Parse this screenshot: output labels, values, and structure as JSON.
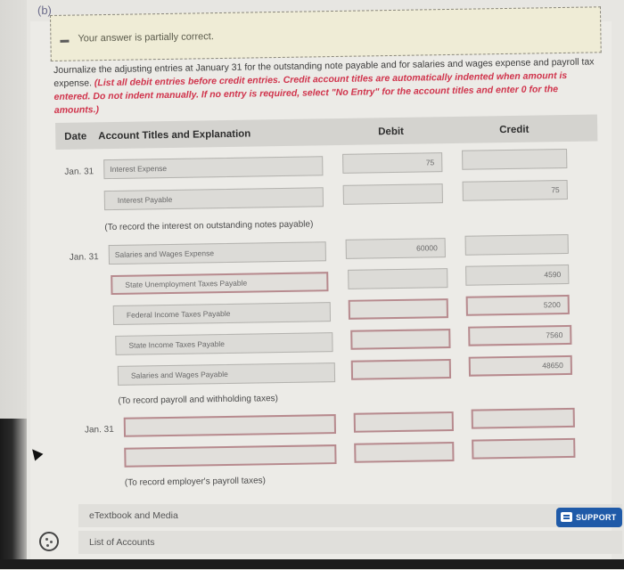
{
  "part_label": "(b)",
  "feedback": {
    "icon": "minus-icon",
    "message": "Your answer is partially correct."
  },
  "instructions": {
    "plain": "Journalize the adjusting entries at January 31 for the outstanding note payable and for salaries and wages expense and payroll tax expense. ",
    "emphasis": "(List all debit entries before credit entries. Credit account titles are automatically indented when amount is entered. Do not indent manually. If no entry is required, select \"No Entry\" for the account titles and enter 0 for the amounts.)"
  },
  "table": {
    "headers": {
      "date": "Date",
      "account": "Account Titles and Explanation",
      "debit": "Debit",
      "credit": "Credit"
    },
    "entries": [
      {
        "date": "Jan. 31",
        "lines": [
          {
            "account": "Interest Expense",
            "debit": "75",
            "credit": "",
            "status": "correct"
          },
          {
            "account": "Interest Payable",
            "debit": "",
            "credit": "75",
            "status": "correct"
          }
        ],
        "explanation": "(To record the interest on outstanding notes payable)"
      },
      {
        "date": "Jan. 31",
        "lines": [
          {
            "account": "Salaries and Wages Expense",
            "debit": "60000",
            "credit": "",
            "status": "correct"
          },
          {
            "account": "State Unemployment Taxes Payable",
            "debit": "",
            "credit": "4590",
            "status": "account-incorrect"
          },
          {
            "account": "Federal Income Taxes Payable",
            "debit": "",
            "credit": "5200",
            "status": "amount-incorrect"
          },
          {
            "account": "State Income Taxes Payable",
            "debit": "",
            "credit": "7560",
            "status": "amount-incorrect"
          },
          {
            "account": "Salaries and Wages Payable",
            "debit": "",
            "credit": "48650",
            "status": "amount-incorrect"
          }
        ],
        "explanation": "(To record payroll and withholding taxes)"
      },
      {
        "date": "Jan. 31",
        "lines": [
          {
            "account": "",
            "debit": "",
            "credit": "",
            "status": "incorrect"
          },
          {
            "account": "",
            "debit": "",
            "credit": "",
            "status": "incorrect"
          }
        ],
        "explanation": "(To record employer's payroll taxes)"
      }
    ]
  },
  "footer": {
    "links": [
      "eTextbook and Media",
      "List of Accounts"
    ],
    "support_label": "SUPPORT"
  }
}
